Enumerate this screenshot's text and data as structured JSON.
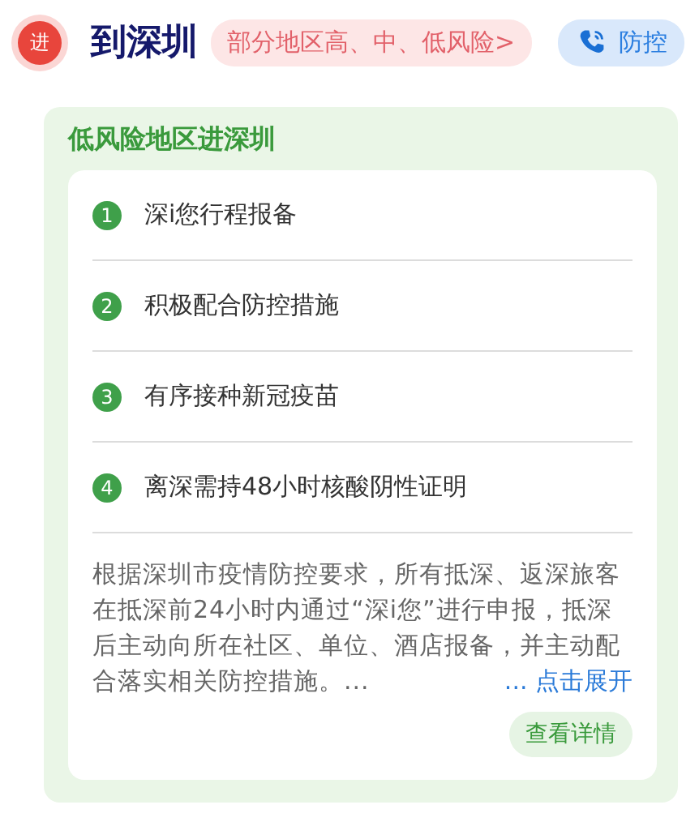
{
  "header": {
    "badge": "进",
    "title": "到深圳",
    "risk_tag": "部分地区高、中、低风险>",
    "action": {
      "label": "防控"
    }
  },
  "panel": {
    "title": "低风险地区进深圳",
    "steps": [
      {
        "number": "1",
        "text": "深i您行程报备"
      },
      {
        "number": "2",
        "text": "积极配合防控措施"
      },
      {
        "number": "3",
        "text": "有序接种新冠疫苗"
      },
      {
        "number": "4",
        "text": "离深需持48小时核酸阴性证明"
      }
    ],
    "description": "根据深圳市疫情防控要求，所有抵深、返深旅客在抵深前24小时内通过“深i您”进行申报，抵深后主动向所在社区、单位、酒店报备，并主动配合落实相关防控措施。...",
    "expand_link": "... 点击展开",
    "details_button": "查看详情"
  }
}
